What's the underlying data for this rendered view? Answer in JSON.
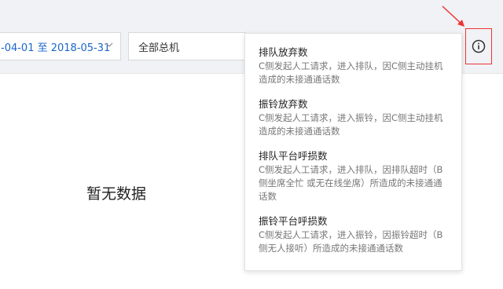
{
  "filters": {
    "date_range": "-04-01 至 2018-05-31",
    "switch": "全部总机"
  },
  "empty_state": "暂无数据",
  "popover": {
    "items": [
      {
        "title": "排队放弃数",
        "desc": "C侧发起人工请求，进入排队，因C侧主动挂机造成的未接通通话数"
      },
      {
        "title": "振铃放弃数",
        "desc": "C侧发起人工请求，进入振铃，因C侧主动挂机造成的未接通通话数"
      },
      {
        "title": "排队平台呼损数",
        "desc": "C侧发起人工请求，进入排队，因排队超时（B侧坐席全忙 或无在线坐席）所造成的未接通通话数"
      },
      {
        "title": "振铃平台呼损数",
        "desc": "C侧发起人工请求，进入振铃，因振铃超时（B侧无人接听）所造成的未接通通话数"
      }
    ]
  },
  "colors": {
    "accent_blue": "#1a66c8",
    "annotation_red": "#e33"
  },
  "icons": {
    "info": "info-circle-icon",
    "dropdown": "chevron-down-icon"
  }
}
